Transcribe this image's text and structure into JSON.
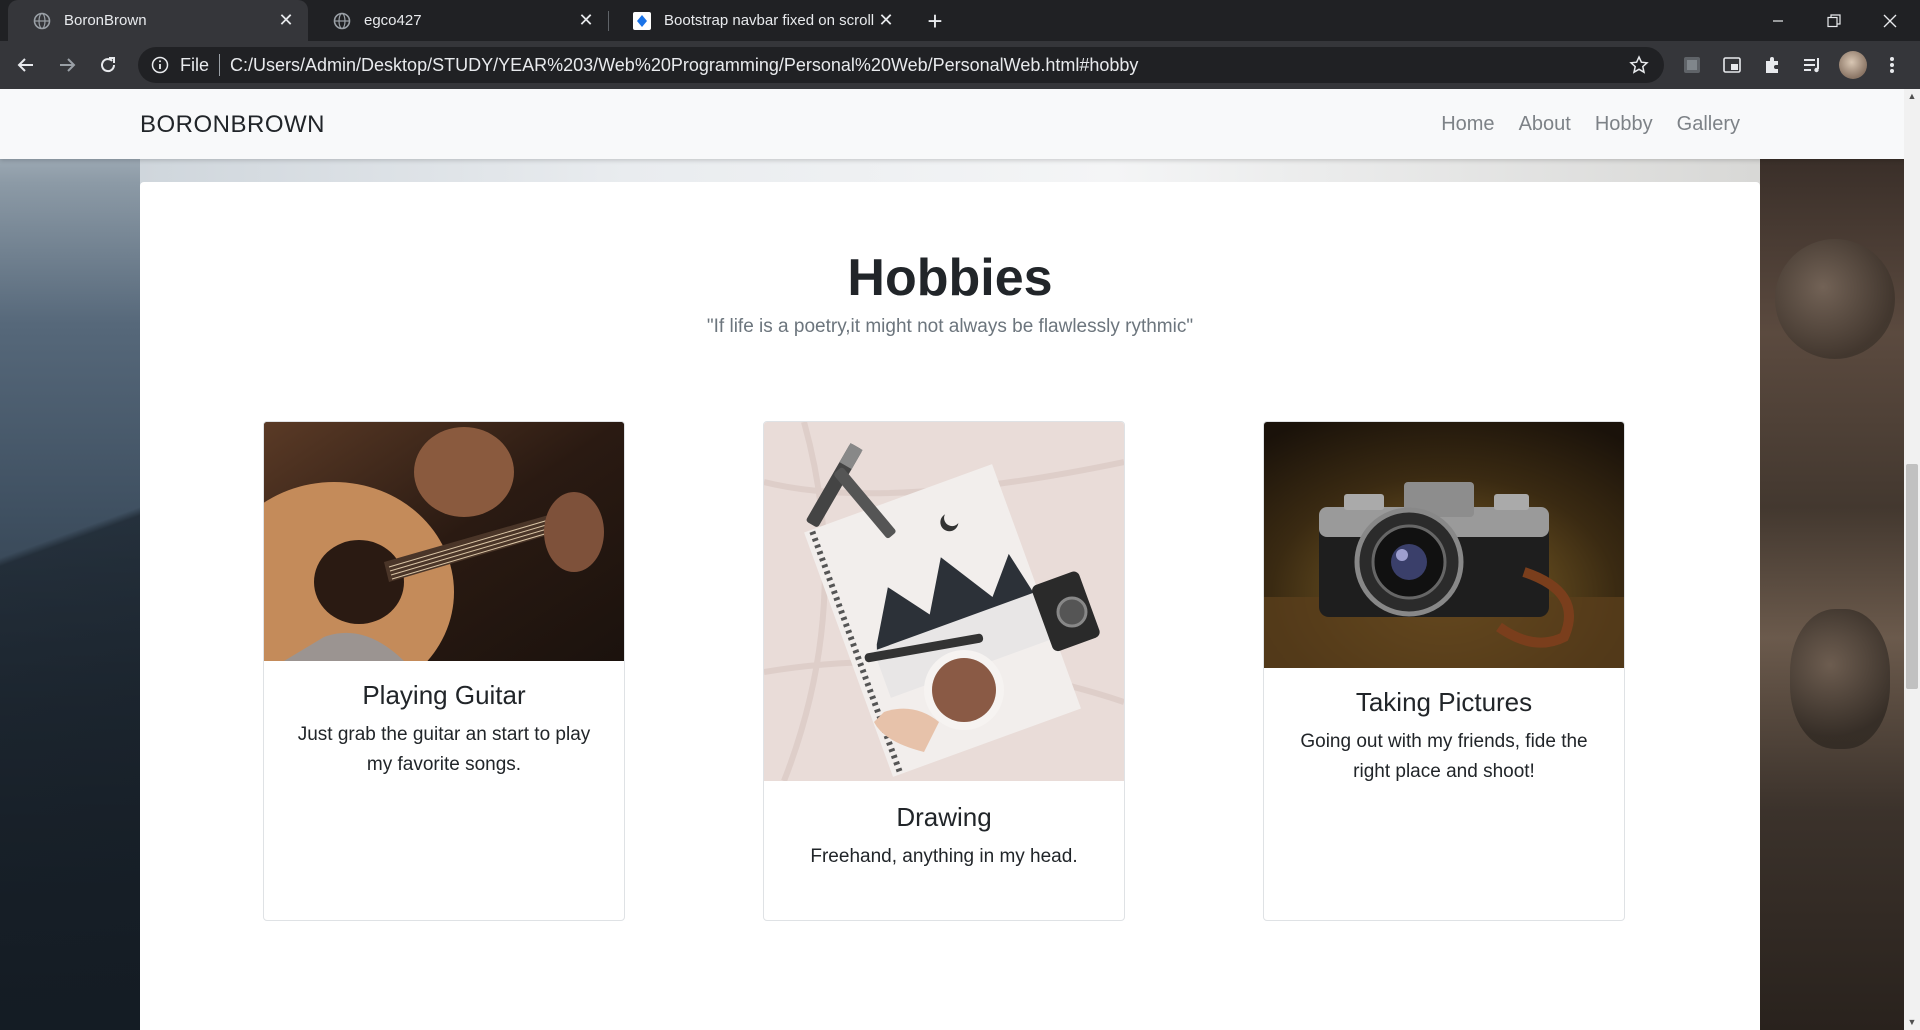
{
  "browser": {
    "tabs": [
      {
        "title": "BoronBrown",
        "active": true
      },
      {
        "title": "egco427",
        "active": false
      },
      {
        "title": "Bootstrap navbar fixed on scroll,",
        "active": false
      }
    ],
    "address": {
      "scheme_label": "File",
      "url": "C:/Users/Admin/Desktop/STUDY/YEAR%203/Web%20Programming/Personal%20Web/PersonalWeb.html#hobby"
    }
  },
  "navbar": {
    "brand": "BORONBROWN",
    "links": [
      "Home",
      "About",
      "Hobby",
      "Gallery"
    ]
  },
  "hobbies": {
    "heading": "Hobbies",
    "quote": "\"If life is a poetry,it might not always be flawlessly rythmic\"",
    "cards": [
      {
        "title": "Playing Guitar",
        "text": "Just grab the guitar an start to play my favorite songs."
      },
      {
        "title": "Drawing",
        "text": "Freehand, anything in my head."
      },
      {
        "title": "Taking Pictures",
        "text": "Going out with my friends, fide the right place and shoot!"
      }
    ]
  },
  "colors": {
    "tabstrip": "#202124",
    "toolbar": "#35363a",
    "navbar_bg": "#f8f9fa",
    "nav_link": "#7d8287"
  }
}
